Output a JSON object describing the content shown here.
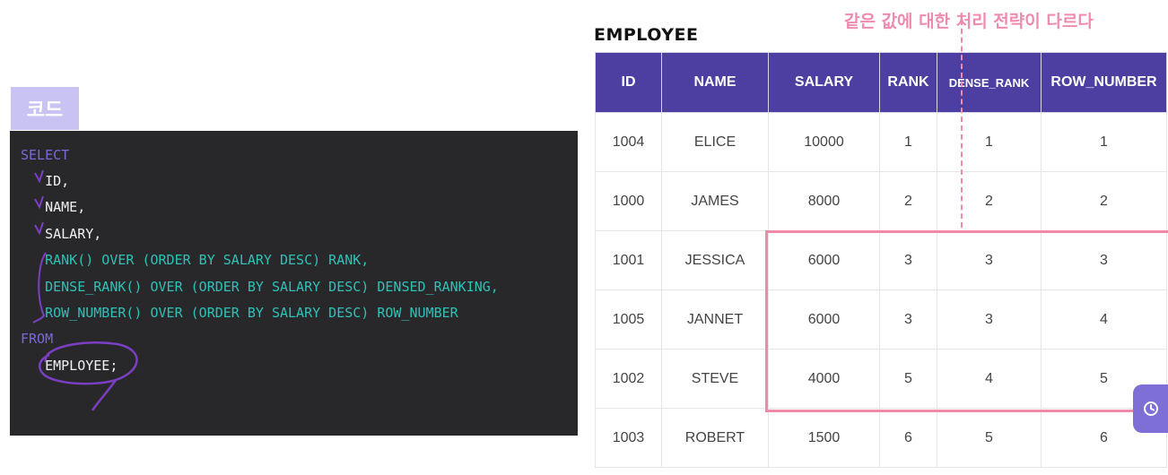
{
  "code_tab": {
    "label": "코드"
  },
  "code": {
    "lines": [
      {
        "indent": "",
        "parts": [
          {
            "cls": "kw",
            "text": "SELECT"
          }
        ]
      },
      {
        "indent": "   ",
        "parts": [
          {
            "cls": "plain",
            "text": "ID,"
          }
        ]
      },
      {
        "indent": "   ",
        "parts": [
          {
            "cls": "plain",
            "text": "NAME,"
          }
        ]
      },
      {
        "indent": "   ",
        "parts": [
          {
            "cls": "plain",
            "text": "SALARY,"
          }
        ]
      },
      {
        "indent": "   ",
        "parts": [
          {
            "cls": "teal",
            "text": "RANK() OVER (ORDER BY SALARY DESC) RANK,"
          }
        ]
      },
      {
        "indent": "   ",
        "parts": [
          {
            "cls": "teal",
            "text": "DENSE_RANK() OVER (ORDER BY SALARY DESC) DENSED_RANKING,"
          }
        ]
      },
      {
        "indent": "   ",
        "parts": [
          {
            "cls": "teal",
            "text": "ROW_NUMBER() OVER (ORDER BY SALARY DESC) ROW_NUMBER"
          }
        ]
      },
      {
        "indent": "",
        "parts": [
          {
            "cls": "kw",
            "text": "FROM"
          }
        ]
      },
      {
        "indent": "   ",
        "parts": [
          {
            "cls": "plain",
            "text": "EMPLOYEE;"
          }
        ]
      }
    ]
  },
  "table": {
    "title": "EMPLOYEE",
    "headers": [
      "ID",
      "NAME",
      "SALARY",
      "RANK",
      "DENSE_RANK",
      "ROW_NUMBER"
    ],
    "rows": [
      [
        "1004",
        "ELICE",
        "10000",
        "1",
        "1",
        "1"
      ],
      [
        "1000",
        "JAMES",
        "8000",
        "2",
        "2",
        "2"
      ],
      [
        "1001",
        "JESSICA",
        "6000",
        "3",
        "3",
        "3"
      ],
      [
        "1005",
        "JANNET",
        "6000",
        "3",
        "3",
        "4"
      ],
      [
        "1002",
        "STEVE",
        "4000",
        "5",
        "4",
        "5"
      ],
      [
        "1003",
        "ROBERT",
        "1500",
        "6",
        "5",
        "6"
      ]
    ]
  },
  "annotation": {
    "note": "같은 값에 대한 처리 전략이 다르다",
    "color": "#f08aa8"
  },
  "colors": {
    "header_bg": "#4c3fa1",
    "code_bg": "#28282a",
    "keyword": "#7b68d9",
    "teal": "#2fc1b7",
    "tab_bg": "#c9c3f4"
  },
  "fab": {
    "icon": "clock-icon"
  }
}
